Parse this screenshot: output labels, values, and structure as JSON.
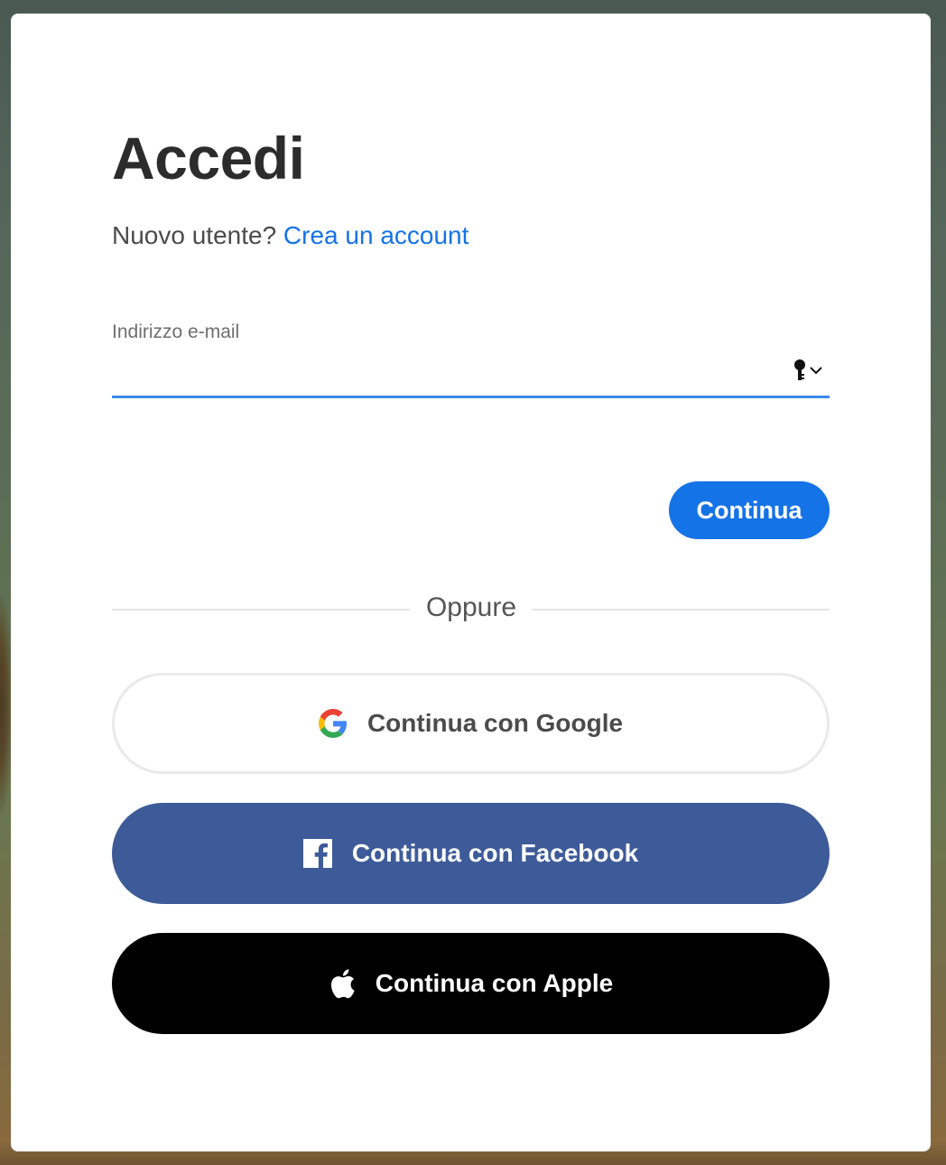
{
  "page": {
    "title": "Accedi",
    "new_user_text": "Nuovo utente?",
    "create_account_link": "Crea un account"
  },
  "email": {
    "label": "Indirizzo e-mail",
    "value": "",
    "password_manager_icon": "key-icon"
  },
  "actions": {
    "continue_label": "Continua",
    "divider_text": "Oppure"
  },
  "social": {
    "google_label": "Continua con Google",
    "facebook_label": "Continua con Facebook",
    "apple_label": "Continua con Apple"
  },
  "colors": {
    "accent": "#1473e6",
    "facebook": "#3d5b99",
    "apple": "#000000",
    "field_underline": "#3d8be8"
  }
}
